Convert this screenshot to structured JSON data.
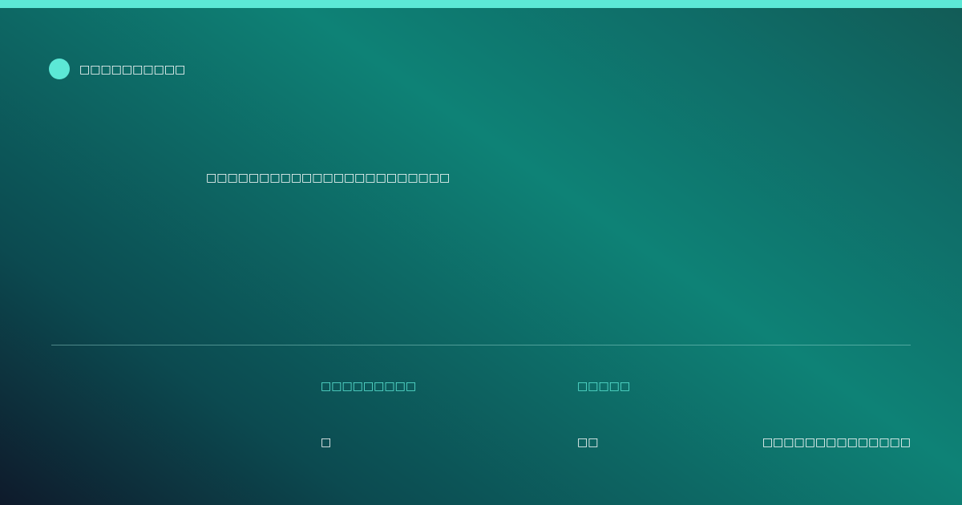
{
  "colors": {
    "accent": "#5ce8d6",
    "text": "#ffffff",
    "gradient_dark": "#0e1a2b",
    "gradient_teal": "#0e8276"
  },
  "brand": {
    "name": "□□□□□□□□□□",
    "icon": "dot-icon"
  },
  "headline": "□□□□□□□□□□□□□□□□□□□□□□□",
  "meta": {
    "col1": {
      "label": "□□□□□□□□□",
      "value": "□"
    },
    "col2": {
      "label": "□□□□□",
      "value": "□□"
    },
    "col3": {
      "value": "□□□□□□□□□□□□□□"
    }
  }
}
